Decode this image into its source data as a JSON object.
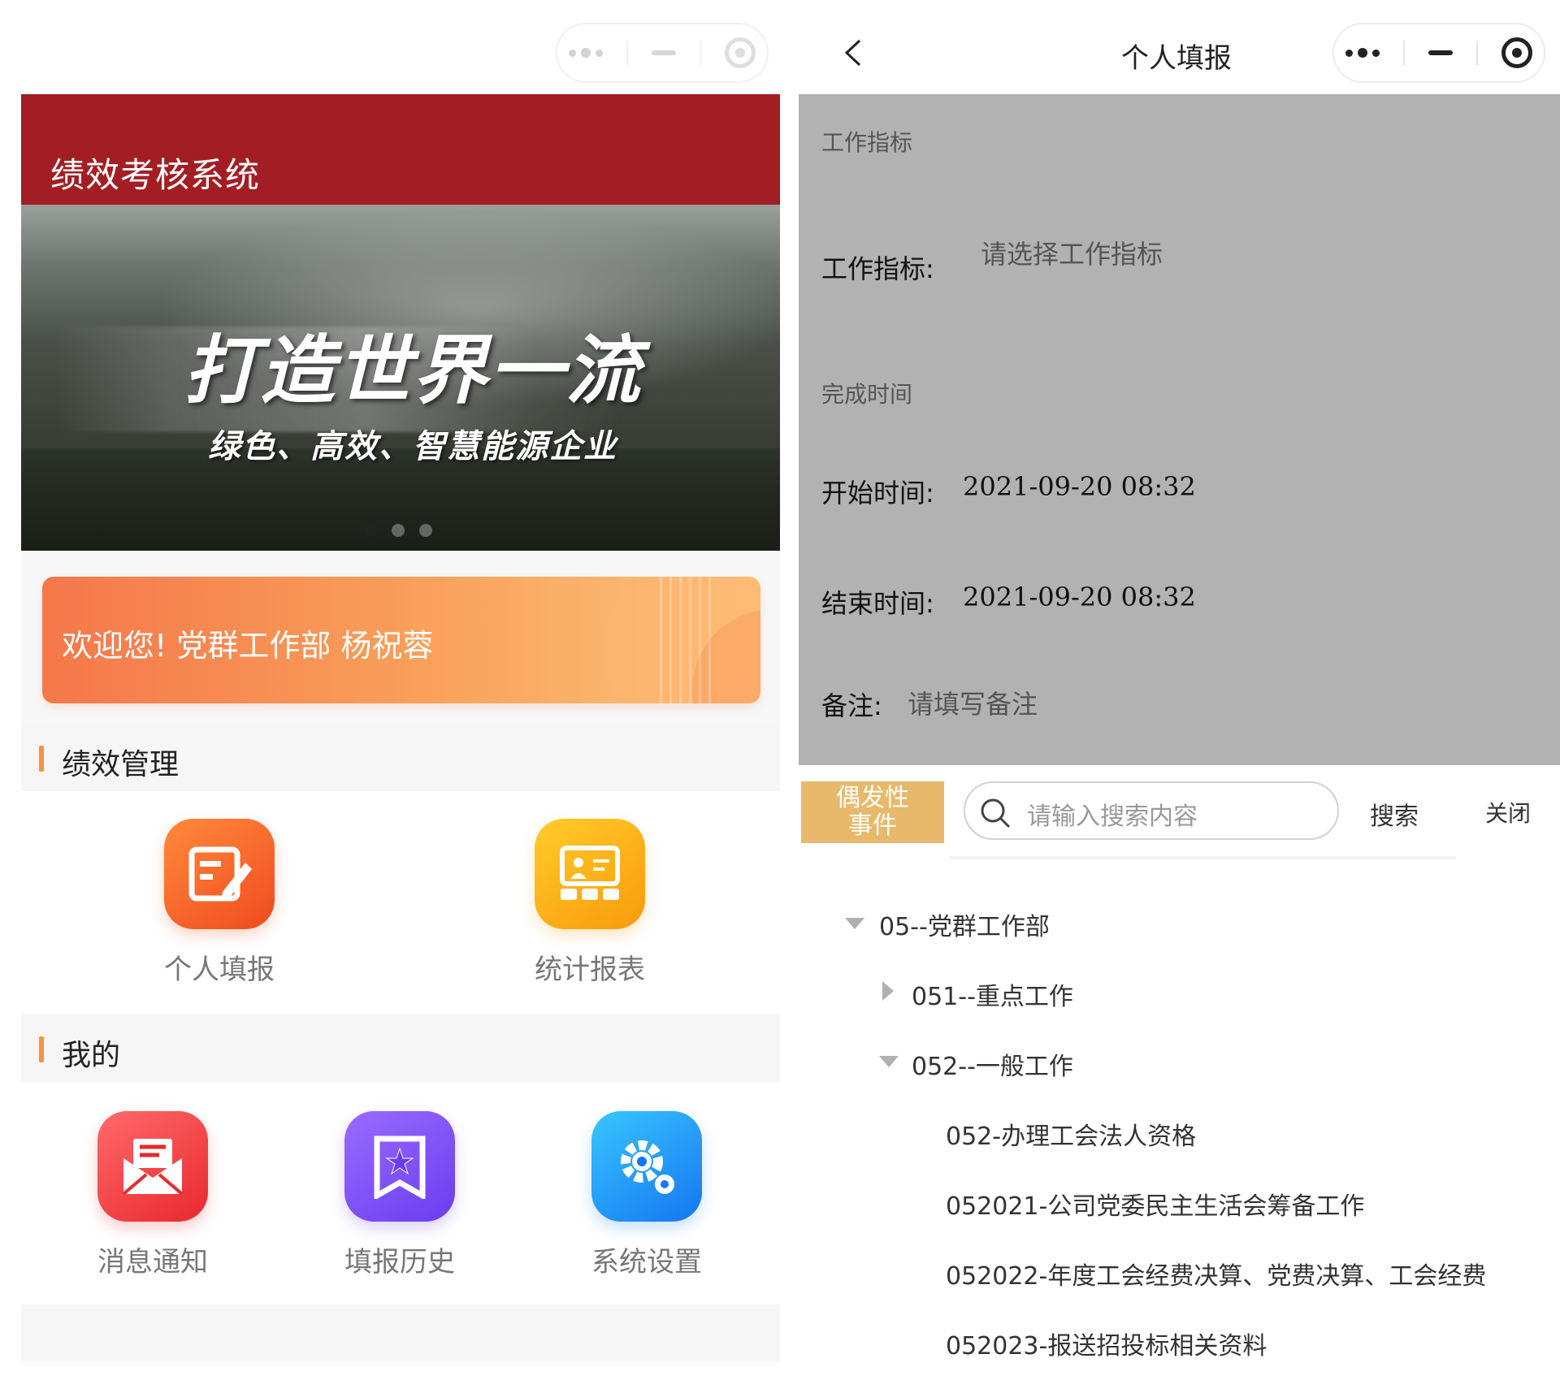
{
  "left": {
    "app_title": "绩效考核系统",
    "banner": {
      "headline": "打造世界一流",
      "subline": "绿色、高效、智慧能源企业",
      "slide_count": 3,
      "active_slide": 1
    },
    "welcome": "欢迎您!  党群工作部   杨祝蓉",
    "sections": [
      {
        "title": "绩效管理",
        "items": [
          {
            "label": "个人填报",
            "icon": "edit-form-icon"
          },
          {
            "label": "统计报表",
            "icon": "report-board-icon"
          }
        ]
      },
      {
        "title": "我的",
        "items": [
          {
            "label": "消息通知",
            "icon": "mail-envelope-icon"
          },
          {
            "label": "填报历史",
            "icon": "bookmark-star-icon"
          },
          {
            "label": "系统设置",
            "icon": "gear-icon"
          }
        ]
      }
    ]
  },
  "right": {
    "nav_title": "个人填报",
    "form": {
      "section1": "工作指标",
      "indicator_label": "工作指标:",
      "indicator_placeholder": "请选择工作指标",
      "section2": "完成时间",
      "start_label": "开始时间:",
      "start_value": "2021-09-20 08:32",
      "end_label": "结束时间:",
      "end_value": "2021-09-20 08:32",
      "remark_label": "备注:",
      "remark_placeholder": "请填写备注"
    },
    "picker": {
      "tag_line1": "偶发性",
      "tag_line2": "事件",
      "search_placeholder": "请输入搜索内容",
      "search_button": "搜索",
      "close_button": "关闭",
      "tree": [
        {
          "label": "05--党群工作部",
          "state": "expanded"
        },
        {
          "label": "051--重点工作",
          "state": "collapsed"
        },
        {
          "label": "052--一般工作",
          "state": "expanded"
        },
        {
          "label": "052-办理工会法人资格",
          "state": "leaf"
        },
        {
          "label": "052021-公司党委民主生活会筹备工作",
          "state": "leaf"
        },
        {
          "label": "052022-年度工会经费决算、党费决算、工会经费",
          "state": "leaf"
        },
        {
          "label": "052023-报送招投标相关资料",
          "state": "leaf"
        }
      ]
    }
  },
  "colors": {
    "brand_red": "#a31e24",
    "accent_orange": "#f7943a",
    "tag_gold": "#e8b96b",
    "overlay_gray": "#b2b2b2"
  }
}
